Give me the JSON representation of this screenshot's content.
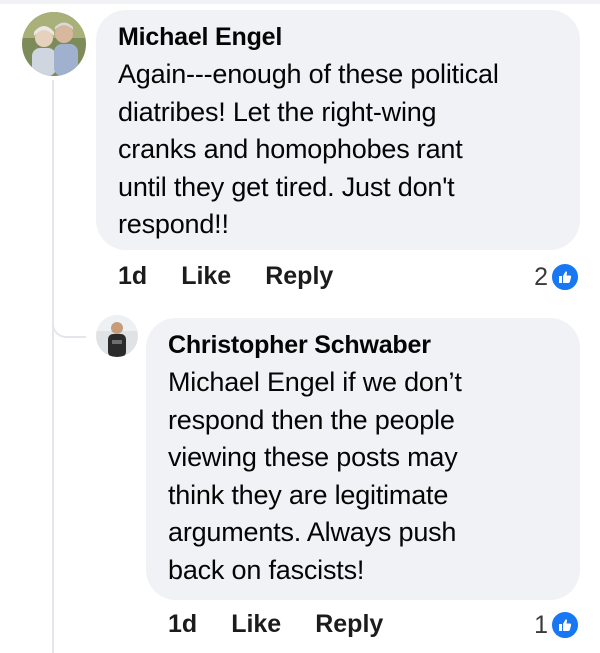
{
  "comments": [
    {
      "author": "Michael Engel",
      "text": "Again---enough of these political\ndiatribes!  Let the right-wing\ncranks and homophobes rant\nuntil they get tired.  Just don't\nrespond!!",
      "time": "1d",
      "like_label": "Like",
      "reply_label": "Reply",
      "reaction_count": "2",
      "reaction_icon": "thumbs-up-icon"
    },
    {
      "author": "Christopher Schwaber",
      "text": "Michael Engel if we don’t\nrespond then the people\nviewing these posts may\nthink they are legitimate\narguments. Always push\nback on fascists!",
      "time": "1d",
      "like_label": "Like",
      "reply_label": "Reply",
      "reaction_count": "1",
      "reaction_icon": "thumbs-up-icon"
    }
  ],
  "colors": {
    "bubble": "#f0f2f5",
    "like_badge": "#1877f2",
    "thread_line": "#e4e6eb"
  }
}
